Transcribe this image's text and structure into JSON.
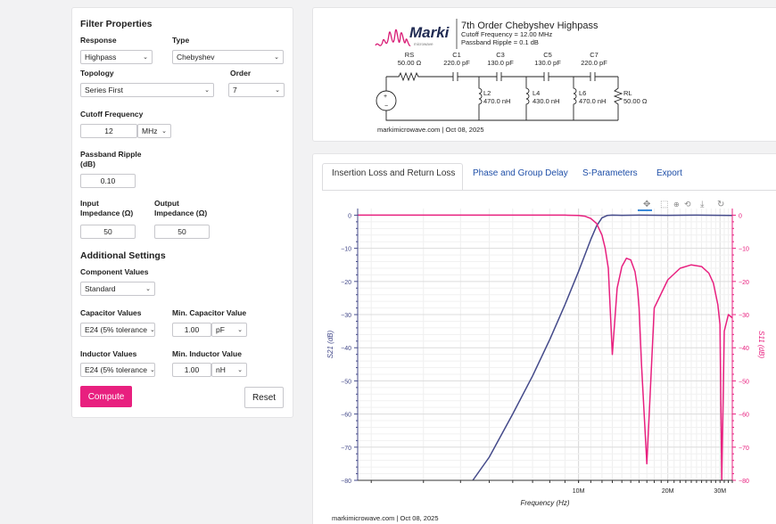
{
  "filter_properties": {
    "title": "Filter Properties",
    "response": {
      "label": "Response",
      "value": "Highpass"
    },
    "type": {
      "label": "Type",
      "value": "Chebyshev"
    },
    "topology": {
      "label": "Topology",
      "value": "Series First"
    },
    "order": {
      "label": "Order",
      "value": "7"
    },
    "cutoff": {
      "label": "Cutoff Frequency",
      "value": "12",
      "unit": "MHz"
    },
    "ripple": {
      "label_line1": "Passband Ripple",
      "label_line2": "(dB)",
      "value": "0.10"
    },
    "input_impedance": {
      "label_line1": "Input",
      "label_line2": "Impedance (Ω)",
      "value": "50"
    },
    "output_impedance": {
      "label_line1": "Output",
      "label_line2": "Impedance (Ω)",
      "value": "50"
    }
  },
  "additional_settings": {
    "title": "Additional Settings",
    "component_values": {
      "label": "Component Values",
      "value": "Standard"
    },
    "capacitor_values": {
      "label": "Capacitor Values",
      "value": "E24 (5% tolerance"
    },
    "min_capacitor": {
      "label": "Min. Capacitor Value",
      "value": "1.00",
      "unit": "pF"
    },
    "inductor_values": {
      "label": "Inductor Values",
      "value": "E24 (5% tolerance"
    },
    "min_inductor": {
      "label": "Min. Inductor Value",
      "value": "1.00",
      "unit": "nH"
    }
  },
  "buttons": {
    "compute": "Compute",
    "reset": "Reset"
  },
  "schematic": {
    "logo": "Marki",
    "logo_sub": "microwave",
    "title": "7th Order Chebyshev Highpass",
    "cutoff_line": "Cutoff Frequency = 12.00 MHz",
    "ripple_line": "Passband Ripple = 0.1 dB",
    "rs_name": "RS",
    "rs_value": "50.00 Ω",
    "c1_name": "C1",
    "c1_value": "220.0 pF",
    "c3_name": "C3",
    "c3_value": "130.0 pF",
    "c5_name": "C5",
    "c5_value": "130.0 pF",
    "c7_name": "C7",
    "c7_value": "220.0 pF",
    "l2_name": "L2",
    "l2_value": "470.0 nH",
    "l4_name": "L4",
    "l4_value": "430.0 nH",
    "l6_name": "L6",
    "l6_value": "470.0 nH",
    "rl_name": "RL",
    "rl_value": "50.00 Ω",
    "footer": "markimicrowave.com | Oct 08, 2025"
  },
  "tabs": [
    "Insertion Loss and Return Loss",
    "Phase and Group Delay",
    "S-Parameters",
    "Export"
  ],
  "plot_footer": "markimicrowave.com | Oct 08, 2025",
  "chart_data": {
    "type": "line",
    "xlabel": "Frequency (Hz)",
    "ylabel_left": "S21 (dB)",
    "ylabel_right": "S11 (dB)",
    "x_scale": "log",
    "x_tick_labels": [
      "10M",
      "20M",
      "30M"
    ],
    "xlim_MHz": [
      1.8,
      33
    ],
    "ylim": [
      -80,
      2
    ],
    "y_ticks": [
      0,
      -10,
      -20,
      -30,
      -40,
      -50,
      -60,
      -70,
      -80
    ],
    "grid": true,
    "colors": {
      "s21": "#444a8a",
      "s11": "#e8207f"
    },
    "series": [
      {
        "name": "S21 (dB)",
        "x_MHz": [
          4.4,
          5,
          6,
          7,
          8,
          9,
          10,
          10.5,
          11,
          11.5,
          12,
          12.5,
          13,
          14,
          16,
          20,
          25,
          30,
          33
        ],
        "y_dB": [
          -80,
          -73,
          -60,
          -48.5,
          -37.5,
          -27,
          -17,
          -12,
          -7.3,
          -3.3,
          -0.8,
          -0.1,
          0,
          -0.05,
          0,
          -0.05,
          0,
          -0.05,
          -0.1
        ]
      },
      {
        "name": "S11 (dB)",
        "x_MHz": [
          1.8,
          9,
          10,
          10.5,
          11,
          11.5,
          12,
          12.3,
          12.6,
          13,
          13.5,
          14,
          14.5,
          15,
          15.5,
          15.8,
          16.0,
          16.3,
          17,
          18,
          20,
          22,
          24,
          26,
          27.5,
          28.5,
          29.5,
          30.0,
          30.4,
          31,
          32,
          33
        ],
        "y_dB": [
          0,
          0,
          -0.1,
          -0.3,
          -1,
          -2.5,
          -6,
          -10,
          -16,
          -42,
          -22,
          -15.5,
          -13,
          -13.5,
          -17,
          -22,
          -28,
          -45,
          -75,
          -28,
          -19.5,
          -16,
          -15,
          -15.5,
          -17.5,
          -20.5,
          -27,
          -33,
          -80,
          -35,
          -30,
          -31
        ]
      }
    ]
  }
}
